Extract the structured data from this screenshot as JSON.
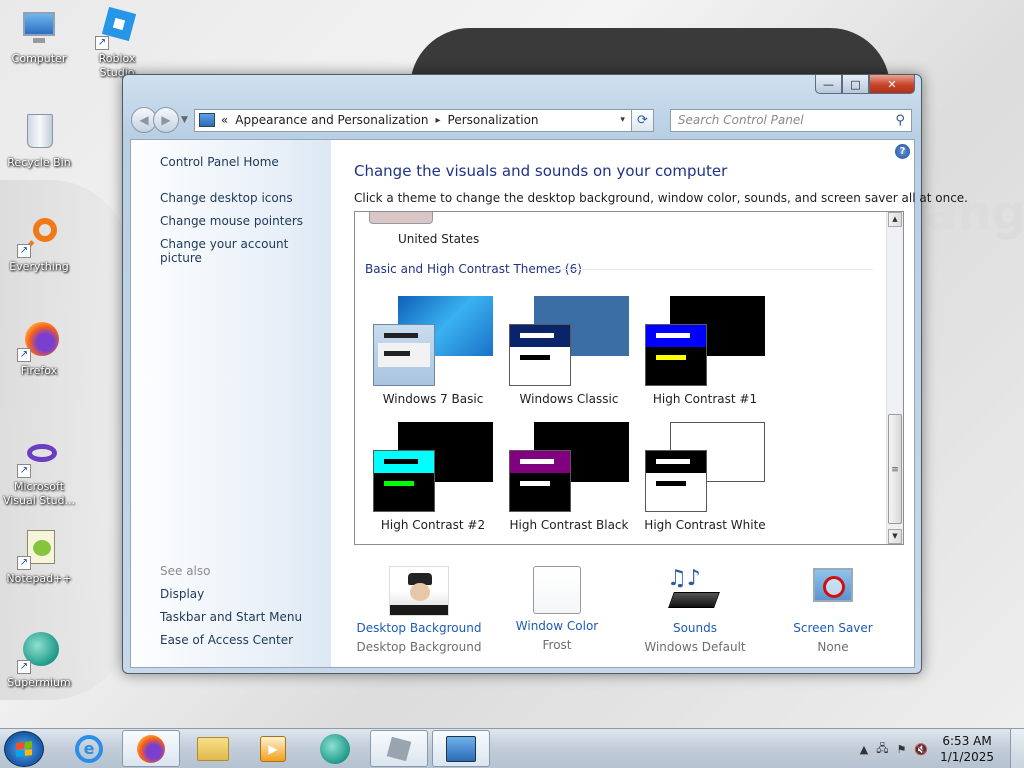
{
  "desktop": {
    "icons": [
      {
        "label": "Computer"
      },
      {
        "label": "Roblox Studio"
      },
      {
        "label": "Recycle Bin"
      },
      {
        "label": "Everything"
      },
      {
        "label": "Firefox"
      },
      {
        "label": "Microsoft Visual Stud..."
      },
      {
        "label": "Notepad++"
      },
      {
        "label": "Supermium"
      }
    ],
    "wallpaper_text": "ang"
  },
  "window": {
    "caption_buttons": {
      "minimize": "—",
      "maximize": "□",
      "close": "✕"
    },
    "address": {
      "chevron": "«",
      "crumbs": [
        "Appearance and Personalization",
        "Personalization"
      ],
      "separator": "▸",
      "dropdown": "▾"
    },
    "search": {
      "placeholder": "Search Control Panel"
    },
    "sidebar": {
      "home": "Control Panel Home",
      "links": [
        "Change desktop icons",
        "Change mouse pointers",
        "Change your account picture"
      ],
      "see_also_title": "See also",
      "see_also": [
        "Display",
        "Taskbar and Start Menu",
        "Ease of Access Center"
      ]
    },
    "main": {
      "title": "Change the visuals and sounds on your computer",
      "description": "Click a theme to change the desktop background, window color, sounds, and screen saver all at once.",
      "help": "?",
      "partial_theme_label": "United States",
      "group_title": "Basic and High Contrast Themes (6)",
      "themes": [
        {
          "name": "Windows 7 Basic"
        },
        {
          "name": "Windows Classic"
        },
        {
          "name": "High Contrast #1"
        },
        {
          "name": "High Contrast #2"
        },
        {
          "name": "High Contrast Black"
        },
        {
          "name": "High Contrast White"
        }
      ],
      "options": [
        {
          "title": "Desktop Background",
          "value": "Desktop Background"
        },
        {
          "title": "Window Color",
          "value": "Frost"
        },
        {
          "title": "Sounds",
          "value": "Windows Default"
        },
        {
          "title": "Screen Saver",
          "value": "None"
        }
      ]
    }
  },
  "taskbar": {
    "time": "6:53 AM",
    "date": "1/1/2025",
    "pinned": [
      "internet-explorer",
      "firefox",
      "file-explorer",
      "media-player",
      "supermium",
      "roblox-studio",
      "control-panel"
    ]
  },
  "colors": {
    "link": "#1c5bb8",
    "heading": "#1e3287",
    "sidebar_text": "#1e395b"
  }
}
